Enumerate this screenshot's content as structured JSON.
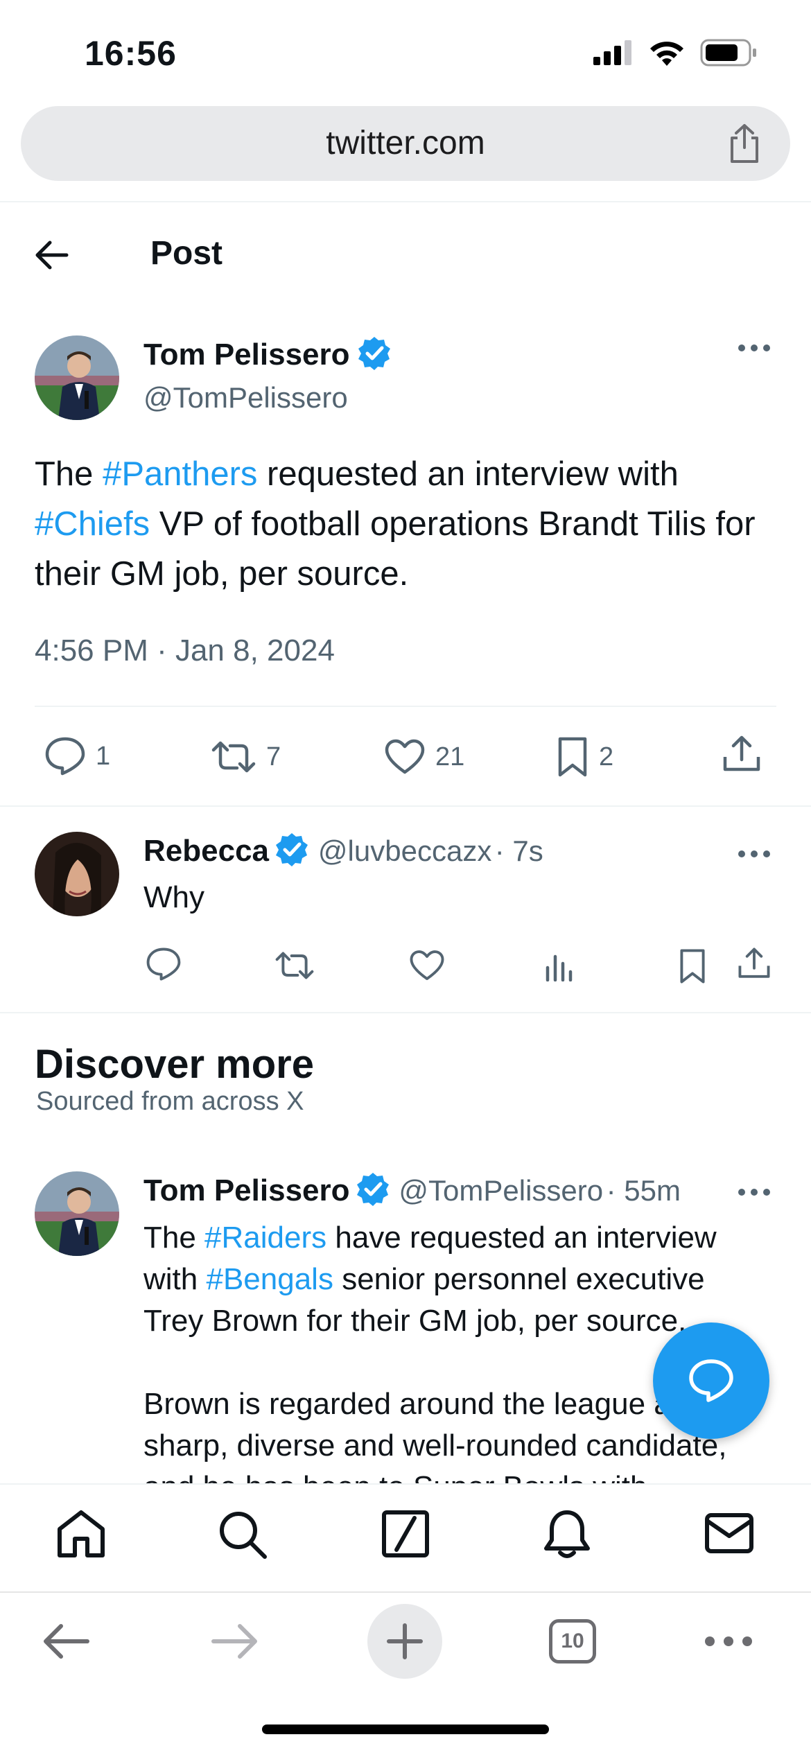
{
  "status_bar": {
    "time": "16:56"
  },
  "browser": {
    "url": "twitter.com",
    "tab_count": "10"
  },
  "header": {
    "title": "Post"
  },
  "main_tweet": {
    "author_name": "Tom Pelissero",
    "author_handle": "@TomPelissero",
    "text_parts": [
      "The ",
      "#Panthers",
      " requested an interview with ",
      "#Chiefs",
      " VP of football operations Brandt Tilis for their GM job, per source."
    ],
    "timestamp": "4:56 PM · Jan 8, 2024",
    "replies": "1",
    "retweets": "7",
    "likes": "21",
    "bookmarks": "2"
  },
  "reply": {
    "author_name": "Rebecca",
    "author_handle": "@luvbeccazx",
    "age": "· 7s",
    "text": "Why"
  },
  "discover": {
    "title": "Discover more",
    "subtitle": "Sourced from across X"
  },
  "discover_tweet": {
    "author_name": "Tom Pelissero",
    "author_handle": "@TomPelissero",
    "age": "· 55m",
    "line1_parts": [
      "The ",
      "#Raiders",
      " have requested an interview"
    ],
    "line2_parts": [
      "with ",
      "#Bengals",
      " senior personnel executive"
    ],
    "line3": "Trey Brown for their GM job, per source.",
    "line4": "Brown is regarded around the league as a",
    "line5": "sharp, diverse and well-rounded candidate,",
    "line6": "and he has been to Super Bowls with"
  },
  "colors": {
    "accent": "#1d9bf0",
    "text": "#0f1419",
    "muted": "#536471"
  }
}
